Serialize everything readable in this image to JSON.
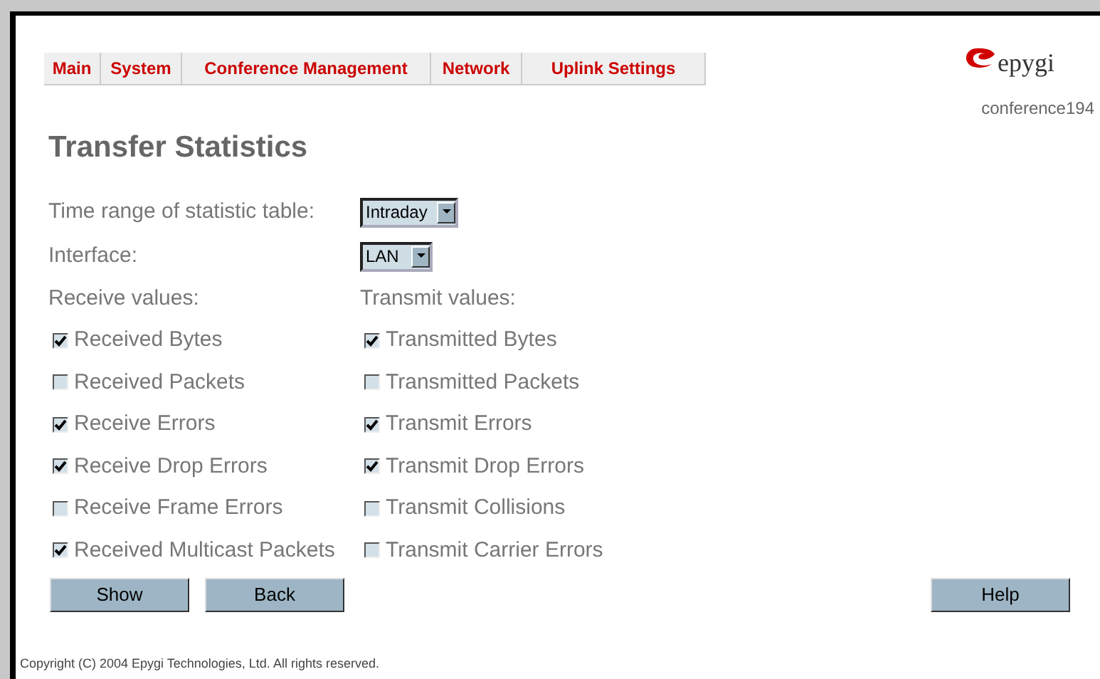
{
  "menu": [
    "Main",
    "System",
    "Conference Management",
    "Network",
    "Uplink Settings"
  ],
  "logo": {
    "text": "epygi"
  },
  "hostname": "conference194",
  "title": "Transfer Statistics",
  "fields": [
    {
      "label": "Time range of statistic table:",
      "value": "Intraday"
    },
    {
      "label": "Interface:",
      "value": "LAN"
    }
  ],
  "receive": {
    "heading": "Receive values:",
    "items": [
      {
        "label": "Received Bytes",
        "checked": true
      },
      {
        "label": "Received Packets",
        "checked": false
      },
      {
        "label": "Receive Errors",
        "checked": true
      },
      {
        "label": "Receive Drop Errors",
        "checked": true
      },
      {
        "label": "Receive Frame Errors",
        "checked": false
      },
      {
        "label": "Received Multicast Packets",
        "checked": true
      }
    ]
  },
  "transmit": {
    "heading": "Transmit values:",
    "items": [
      {
        "label": "Transmitted Bytes",
        "checked": true
      },
      {
        "label": "Transmitted Packets",
        "checked": false
      },
      {
        "label": "Transmit Errors",
        "checked": true
      },
      {
        "label": "Transmit Drop Errors",
        "checked": true
      },
      {
        "label": "Transmit Collisions",
        "checked": false
      },
      {
        "label": "Transmit Carrier Errors",
        "checked": false
      }
    ]
  },
  "buttons": [
    "Show",
    "Back"
  ],
  "help_button": "Help",
  "footer": "Copyright (C) 2004 Epygi Technologies, Ltd. All rights reserved."
}
